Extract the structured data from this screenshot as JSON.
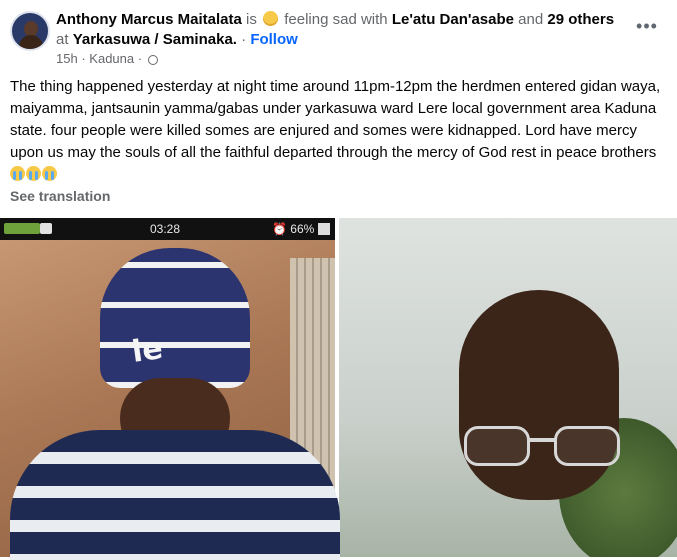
{
  "post": {
    "author": "Anthony Marcus Maitalata",
    "is_text": "is",
    "feeling_text": "feeling sad with",
    "tagged_person": "Le'atu Dan'asabe",
    "and_text": "and",
    "others_count_text": "29 others",
    "at_text": "at",
    "location": "Yarkasuwa / Saminaka.",
    "separator": "·",
    "follow_label": "Follow",
    "time": "15h",
    "dot": "·",
    "meta_location": "Kaduna",
    "meta_dot": "·",
    "more_label": "•••",
    "body": "The thing happened yesterday at night time around 11pm-12pm the herdmen entered gidan waya, maiyamma, jantsaunin yamma/gabas  under yarkasuwa ward Lere local government area Kaduna state. four people were killed somes are enjured and somes were kidnapped. Lord have mercy upon us may the souls of all the faithful departed through the mercy of God rest in peace brothers",
    "see_translation": "See translation"
  },
  "photos": {
    "left": {
      "status_time": "03:28",
      "status_battery": "⏰ 66%",
      "beanie_text": "le"
    }
  },
  "colors": {
    "follow_blue": "#0866ff",
    "muted_gray": "#65676b"
  },
  "icons": [
    "feeling-sad-emoji-icon",
    "globe-icon",
    "crying-emoji-icon",
    "more-options-icon"
  ]
}
